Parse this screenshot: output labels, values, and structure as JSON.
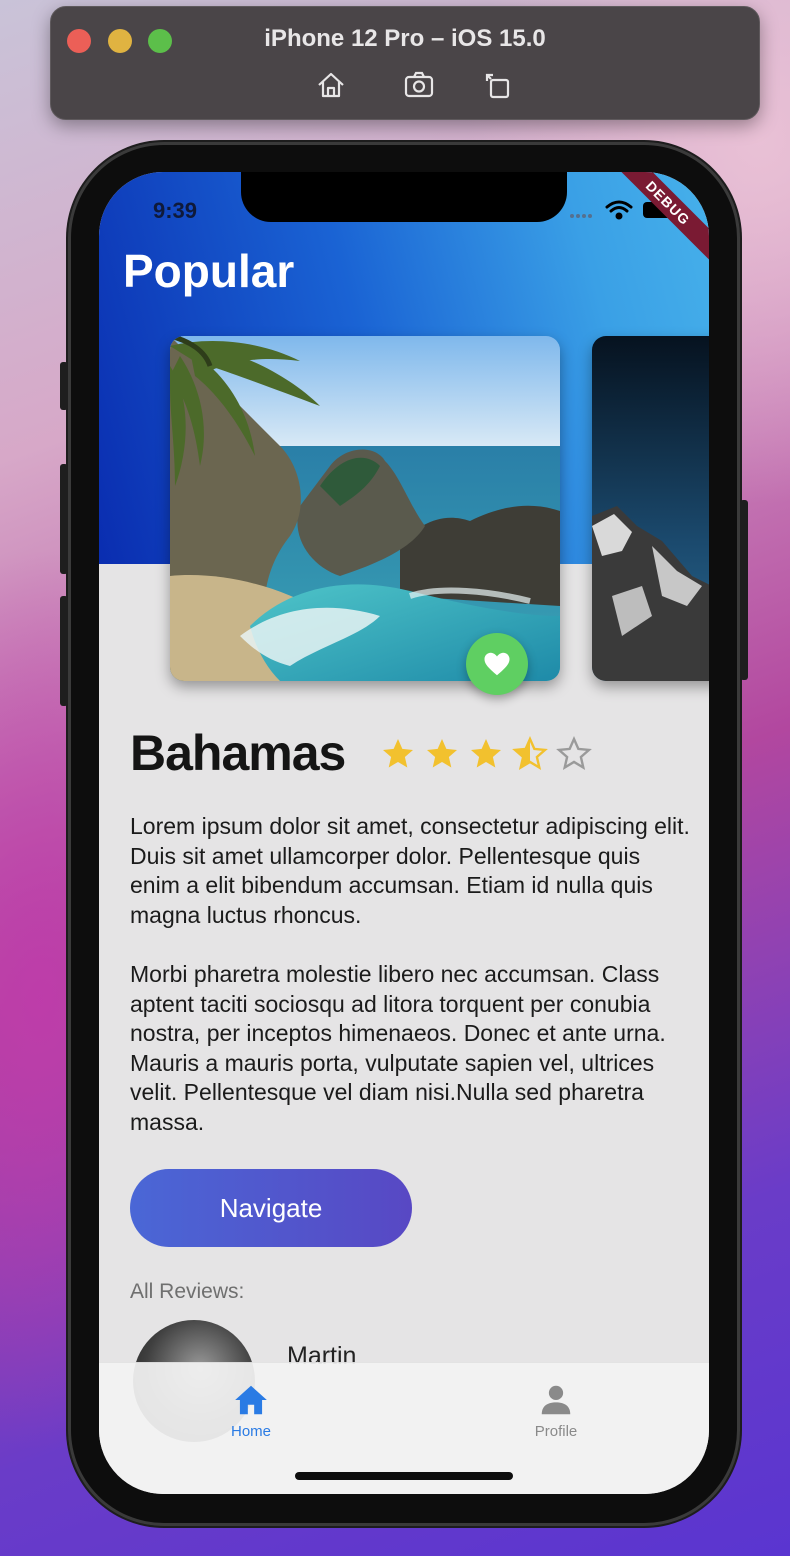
{
  "simulator": {
    "title": "iPhone 12 Pro – iOS 15.0",
    "tools": [
      "home-icon",
      "screenshot-icon",
      "rotate-icon"
    ]
  },
  "status_bar": {
    "time": "9:39",
    "icons": [
      "signal-dots-icon",
      "wifi-icon",
      "battery-icon"
    ],
    "debug_banner": "DEBUG"
  },
  "header": {
    "title": "Popular"
  },
  "place": {
    "name": "Bahamas",
    "rating": 3.5,
    "rating_max": 5,
    "description": [
      "Lorem ipsum dolor sit amet, consectetur adipiscing elit. Duis sit amet ullamcorper dolor. Pellentesque quis enim a elit bibendum accumsan. Etiam id nulla quis magna luctus rhoncus.",
      "Morbi pharetra molestie libero nec accumsan. Class aptent taciti sociosqu ad litora torquent per conubia nostra, per inceptos himenaeos. Donec et ante urna. Mauris a mauris porta, vulputate sapien vel, ultrices velit. Pellentesque vel diam nisi.Nulla sed pharetra massa."
    ],
    "navigate_label": "Navigate"
  },
  "reviews": {
    "label": "All Reviews:",
    "items": [
      {
        "name": "Martin"
      }
    ]
  },
  "tabbar": {
    "items": [
      {
        "label": "Home",
        "icon": "home-icon",
        "active": true
      },
      {
        "label": "Profile",
        "icon": "person-icon",
        "active": false
      }
    ]
  },
  "colors": {
    "accent_blue": "#2a7be4",
    "favorite_green": "#5fcf62",
    "star_gold": "#f2c12e",
    "inactive_gray": "#8a8a8a"
  }
}
